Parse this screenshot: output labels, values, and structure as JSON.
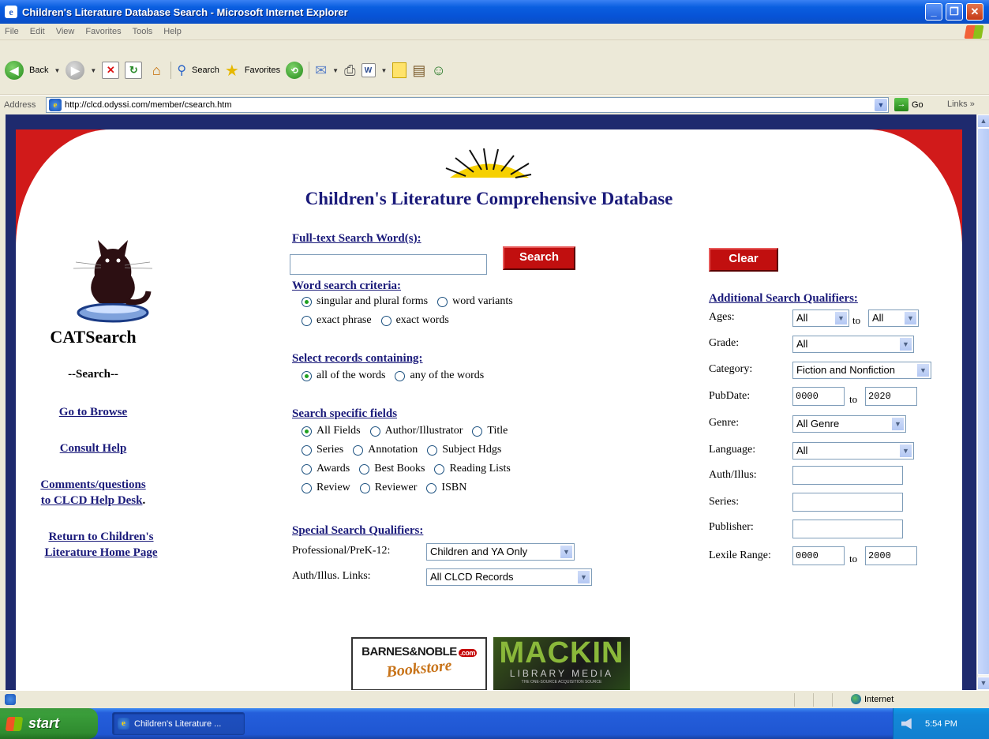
{
  "window": {
    "title": "Children's Literature Database Search - Microsoft Internet Explorer"
  },
  "menu": [
    "File",
    "Edit",
    "View",
    "Favorites",
    "Tools",
    "Help"
  ],
  "toolbar": {
    "back": "Back",
    "search": "Search",
    "favorites": "Favorites"
  },
  "address": {
    "label": "Address",
    "url": "http://clcd.odyssi.com/member/csearch.htm",
    "go": "Go",
    "links": "Links"
  },
  "page": {
    "title": "Children's Literature Comprehensive Database",
    "sidebar": {
      "brand": "CATSearch",
      "current": "--Search--",
      "browse": "Go to Browse",
      "help": "Consult Help",
      "comments_1": "Comments/questions",
      "comments_2": "to CLCD Help Desk",
      "comments_period": ".",
      "return_1": "Return to Children's",
      "return_2": "Literature Home Page"
    },
    "fulltext": {
      "heading": "Full-text Search Word(s):",
      "value": "",
      "search_button": "Search",
      "clear_button": "Clear"
    },
    "criteria": {
      "heading": "Word search criteria:",
      "options": [
        "singular and plural forms",
        "word variants",
        "exact phrase",
        "exact words"
      ],
      "selected": "singular and plural forms"
    },
    "records": {
      "heading": "Select records containing:",
      "options": [
        "all of the words",
        "any of the words"
      ],
      "selected": "all of the words"
    },
    "fields": {
      "heading": "Search specific fields",
      "options": [
        "All Fields",
        "Author/Illustrator",
        "Title",
        "Series",
        "Annotation",
        "Subject Hdgs",
        "Awards",
        "Best Books",
        "Reading Lists",
        "Review",
        "Reviewer",
        "ISBN"
      ],
      "selected": "All Fields"
    },
    "special": {
      "heading": "Special Search Qualifiers:",
      "professional_label": "Professional/PreK-12:",
      "professional_value": "Children and YA Only",
      "links_label": "Auth/Illus. Links:",
      "links_value": "All CLCD Records"
    },
    "additional": {
      "heading": "Additional Search Qualifiers:",
      "ages_label": "Ages:",
      "ages_from": "All",
      "ages_to": "All",
      "to": "to",
      "grade_label": "Grade:",
      "grade_value": "All",
      "category_label": "Category:",
      "category_value": "Fiction and Nonfiction",
      "pubdate_label": "PubDate:",
      "pubdate_from": "0000",
      "pubdate_to": "2020",
      "genre_label": "Genre:",
      "genre_value": "All Genre",
      "language_label": "Language:",
      "language_value": "All",
      "authillus_label": "Auth/Illus:",
      "series_label": "Series:",
      "publisher_label": "Publisher:",
      "lexile_label": "Lexile Range:",
      "lexile_from": "0000",
      "lexile_to": "2000"
    },
    "ads": {
      "bn_1": "BARNES&NOBLE",
      "bn_com": ".com",
      "bn_2": "Bookstore",
      "mackin_1": "MACKIN",
      "mackin_2": "LIBRARY MEDIA",
      "mackin_3": "THE ONE-SOURCE ACQUISITION SOURCE"
    }
  },
  "status": {
    "zone": "Internet"
  },
  "taskbar": {
    "start": "start",
    "task": "Children's Literature ...",
    "clock": "5:54 PM"
  }
}
